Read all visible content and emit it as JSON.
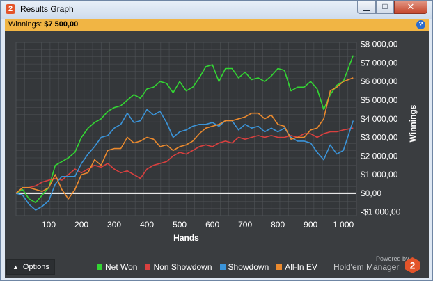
{
  "window": {
    "title": "Results Graph",
    "logo_glyph": "2",
    "minimize_glyph": "▁",
    "maximize_glyph": "□",
    "close_glyph": "✕"
  },
  "infobar": {
    "label": "Winnings: ",
    "value": "$7 500,00",
    "help_glyph": "?"
  },
  "footer": {
    "options_label": "Options",
    "options_caret": "▲",
    "powered_by": "Powered by",
    "brand": "Hold'em Manager",
    "brand_logo_glyph": "2"
  },
  "colors": {
    "background": "#3a3d40",
    "grid": "#4f5357",
    "zero_line": "#ffffff",
    "net_won": "#33d633",
    "non_showdown": "#d9403f",
    "showdown": "#3b94d9",
    "all_in_ev": "#eb8a2e",
    "brand_logo": "#e3542a"
  },
  "icons": {
    "app": "hm2-logo-icon",
    "help": "help-icon",
    "options": "chevron-up-icon",
    "brand": "hm2-logo-icon"
  },
  "chart_data": {
    "type": "line",
    "xlabel": "Hands",
    "ylabel": "Winnings",
    "xlim": [
      0,
      1040
    ],
    "ylim": [
      -1200,
      8100
    ],
    "x_ticks": [
      100,
      200,
      300,
      400,
      500,
      600,
      700,
      800,
      900,
      1000
    ],
    "x_tick_labels": [
      "100",
      "200",
      "300",
      "400",
      "500",
      "600",
      "700",
      "800",
      "900",
      "1 000"
    ],
    "y_ticks": [
      -1000,
      0,
      1000,
      2000,
      3000,
      4000,
      5000,
      6000,
      7000,
      8000
    ],
    "y_tick_labels": [
      "-$1 000,00",
      "$0,00",
      "$1 000,00",
      "$2 000,00",
      "$3 000,00",
      "$4 000,00",
      "$5 000,00",
      "$6 000,00",
      "$7 000,00",
      "$8 000,00"
    ],
    "legend_position": "bottom",
    "grid": true,
    "series": [
      {
        "name": "Net Won",
        "color": "#33d633",
        "x": [
          0,
          20,
          40,
          60,
          80,
          100,
          120,
          140,
          160,
          180,
          200,
          220,
          240,
          260,
          280,
          300,
          320,
          340,
          360,
          380,
          400,
          420,
          440,
          460,
          480,
          500,
          520,
          540,
          560,
          580,
          600,
          620,
          640,
          660,
          680,
          700,
          720,
          740,
          760,
          780,
          800,
          820,
          840,
          860,
          880,
          900,
          920,
          940,
          960,
          980,
          1000,
          1030
        ],
        "values": [
          0,
          200,
          -300,
          -500,
          -100,
          300,
          1500,
          1700,
          1900,
          2200,
          3000,
          3500,
          3800,
          4000,
          4400,
          4600,
          4700,
          5000,
          5300,
          5100,
          5600,
          5700,
          6000,
          5900,
          5400,
          6000,
          5500,
          5700,
          6200,
          6800,
          6900,
          6000,
          6700,
          6700,
          6200,
          6500,
          6100,
          6200,
          6000,
          6300,
          6700,
          6600,
          5500,
          5700,
          5700,
          6000,
          5600,
          4500,
          5300,
          5800,
          6000,
          7400
        ]
      },
      {
        "name": "Non Showdown",
        "color": "#d9403f",
        "x": [
          0,
          20,
          40,
          60,
          80,
          100,
          120,
          140,
          160,
          180,
          200,
          220,
          240,
          260,
          280,
          300,
          320,
          340,
          360,
          380,
          400,
          420,
          440,
          460,
          480,
          500,
          520,
          540,
          560,
          580,
          600,
          620,
          640,
          660,
          680,
          700,
          720,
          740,
          760,
          780,
          800,
          820,
          840,
          860,
          880,
          900,
          920,
          940,
          960,
          980,
          1000,
          1030
        ],
        "values": [
          0,
          300,
          300,
          400,
          600,
          700,
          800,
          700,
          1000,
          1300,
          1100,
          1300,
          1500,
          1400,
          1600,
          1300,
          1100,
          1200,
          1000,
          800,
          1300,
          1500,
          1600,
          1700,
          2000,
          2200,
          2100,
          2300,
          2500,
          2600,
          2500,
          2700,
          2800,
          2700,
          3000,
          2900,
          3000,
          3100,
          3000,
          3100,
          3000,
          3000,
          3100,
          3000,
          3200,
          3200,
          3000,
          3200,
          3300,
          3300,
          3400,
          3500
        ]
      },
      {
        "name": "Showdown",
        "color": "#3b94d9",
        "x": [
          0,
          20,
          40,
          60,
          80,
          100,
          120,
          140,
          160,
          180,
          200,
          220,
          240,
          260,
          280,
          300,
          320,
          340,
          360,
          380,
          400,
          420,
          440,
          460,
          480,
          500,
          520,
          540,
          560,
          580,
          600,
          620,
          640,
          660,
          680,
          700,
          720,
          740,
          760,
          780,
          800,
          820,
          840,
          860,
          880,
          900,
          920,
          940,
          960,
          980,
          1000,
          1030
        ],
        "values": [
          0,
          -100,
          -600,
          -900,
          -700,
          -400,
          500,
          900,
          900,
          900,
          1600,
          2100,
          2500,
          3000,
          3100,
          3500,
          3700,
          4300,
          3800,
          3900,
          4500,
          4200,
          4400,
          3800,
          3000,
          3300,
          3400,
          3600,
          3700,
          3700,
          3800,
          3600,
          3900,
          3900,
          3400,
          3700,
          3500,
          3600,
          3300,
          3500,
          3300,
          3500,
          3000,
          2800,
          2800,
          2700,
          2200,
          1800,
          2600,
          2100,
          2300,
          3900
        ]
      },
      {
        "name": "All-In EV",
        "color": "#eb8a2e",
        "x": [
          0,
          20,
          40,
          60,
          80,
          100,
          120,
          140,
          160,
          180,
          200,
          220,
          240,
          260,
          280,
          300,
          320,
          340,
          360,
          380,
          400,
          420,
          440,
          460,
          480,
          500,
          520,
          540,
          560,
          580,
          600,
          620,
          640,
          660,
          680,
          700,
          720,
          740,
          760,
          780,
          800,
          820,
          840,
          860,
          880,
          900,
          920,
          940,
          960,
          980,
          1000,
          1030
        ],
        "values": [
          0,
          300,
          300,
          200,
          100,
          300,
          1000,
          200,
          -300,
          200,
          1000,
          1100,
          1800,
          1500,
          2300,
          2400,
          2400,
          3000,
          2700,
          2800,
          3000,
          2900,
          2500,
          2600,
          2300,
          2500,
          2600,
          2800,
          3200,
          3500,
          3600,
          3700,
          3900,
          3900,
          4000,
          4100,
          4300,
          4300,
          4000,
          4200,
          3700,
          3600,
          2900,
          3000,
          3000,
          3400,
          3500,
          4000,
          5500,
          5700,
          6000,
          6200
        ]
      }
    ]
  }
}
